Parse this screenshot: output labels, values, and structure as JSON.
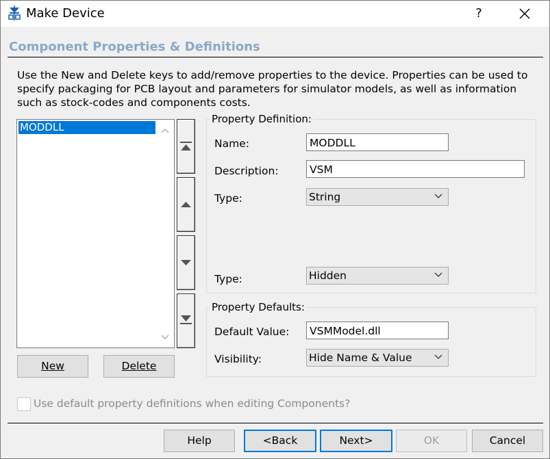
{
  "window": {
    "title": "Make Device",
    "help_glyph": "?",
    "close_icon": "close-icon",
    "app_icon": "diode-icon"
  },
  "section": {
    "title": "Component Properties & Definitions",
    "title_color": "#8aa8c8"
  },
  "description": "Use the New and Delete keys to add/remove properties to the device. Properties can be used to specify packaging for PCB layout and parameters for simulator models, as well as information such as stock-codes and components costs.",
  "property_list": {
    "items": [
      "MODDLL"
    ],
    "selected": "MODDLL",
    "selection_color": "#0078d7"
  },
  "list_buttons": {
    "new": "New",
    "delete": "Delete"
  },
  "move_buttons": [
    "move-top-icon",
    "move-up-icon",
    "move-down-icon",
    "move-bottom-icon"
  ],
  "definition": {
    "group_title": "Property Definition:",
    "name_label": "Name:",
    "name_value": "MODDLL",
    "description_label": "Description:",
    "description_value": "VSM",
    "type_label": "Type:",
    "type_value": "String",
    "type2_label": "Type:",
    "type2_value": "Hidden"
  },
  "defaults": {
    "group_title": "Property Defaults:",
    "default_value_label": "Default Value:",
    "default_value": "VSMModel.dll",
    "visibility_label": "Visibility:",
    "visibility_value": "Hide Name & Value"
  },
  "checkbox": {
    "label": "Use default property definitions when editing Components?",
    "checked": false
  },
  "footer": {
    "help": "Help",
    "back": "<Back",
    "next": "Next>",
    "ok": "OK",
    "cancel": "Cancel"
  }
}
